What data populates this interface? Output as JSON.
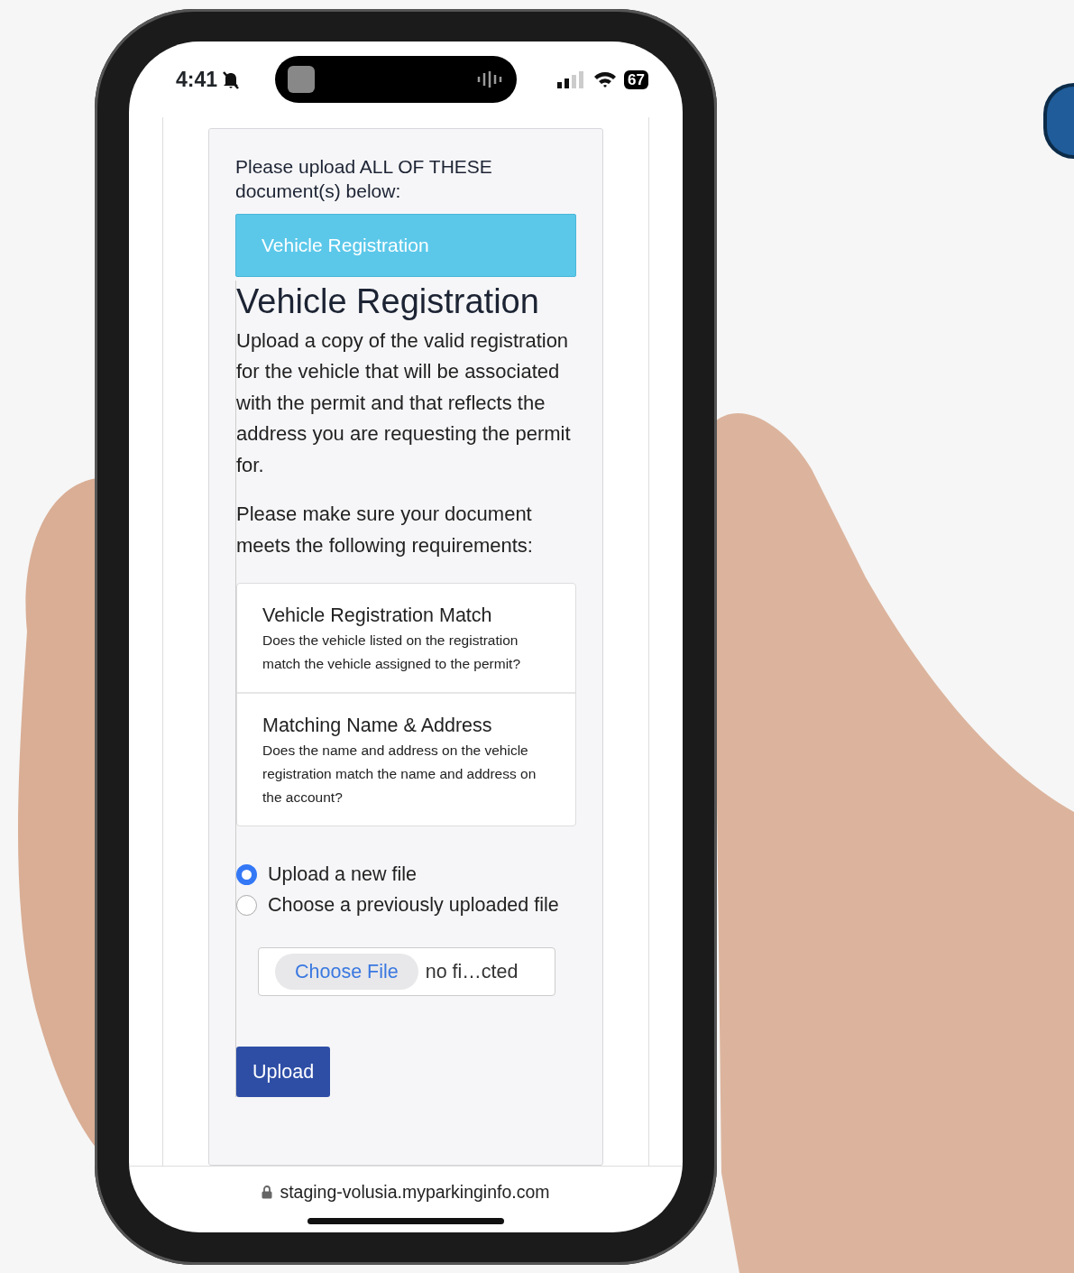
{
  "status_bar": {
    "time": "4:41",
    "battery": "67"
  },
  "prompt": "Please upload ALL OF THESE document(s) below:",
  "document_tabs": [
    {
      "label": "Vehicle Registration",
      "selected": true
    }
  ],
  "heading": "Vehicle Registration",
  "description": "Upload a copy of the valid registration for the vehicle that will be associated with the permit and that reflects the address you are requesting the permit for.",
  "requirements_intro": "Please make sure your document meets the following requirements:",
  "requirements": [
    {
      "title": "Vehicle Registration Match",
      "text": "Does the vehicle listed on the registration match the vehicle assigned to the permit?"
    },
    {
      "title": "Matching Name & Address",
      "text": "Does the name and address on the vehicle registration match the name and address on the account?"
    }
  ],
  "upload_options": [
    {
      "label": "Upload a new file",
      "selected": true
    },
    {
      "label": "Choose a previously uploaded file",
      "selected": false
    }
  ],
  "file_input": {
    "button": "Choose File",
    "status": "no fi…cted"
  },
  "upload_button": "Upload",
  "address_bar": {
    "url": "staging-volusia.myparkinginfo.com"
  }
}
